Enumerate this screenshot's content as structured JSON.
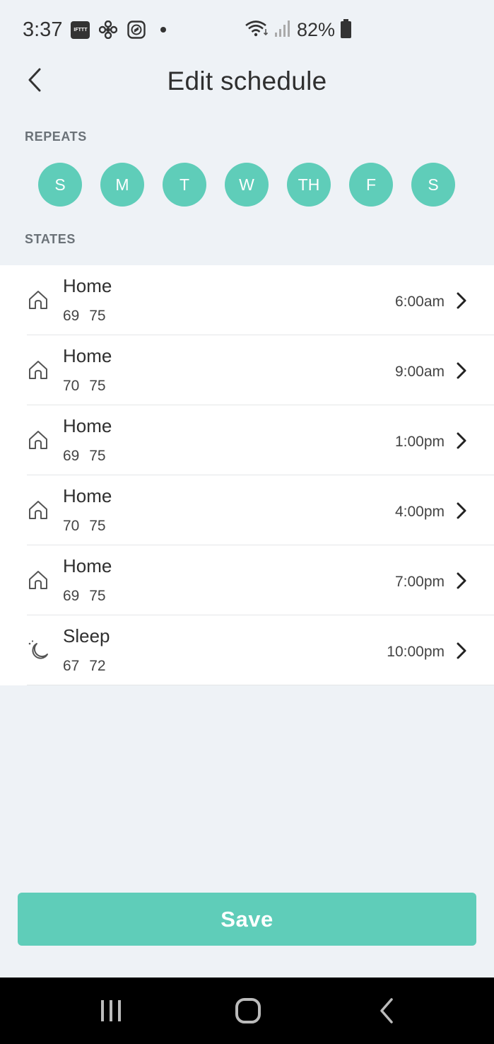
{
  "status_bar": {
    "time": "3:37",
    "icons": [
      "ifttt-icon",
      "fan-icon",
      "shazam-icon",
      "dot-icon",
      "wifi-icon",
      "signal-icon",
      "battery-icon"
    ],
    "ifttt_text": "IFTTT",
    "battery_percent": "82%"
  },
  "header": {
    "title": "Edit schedule",
    "back_icon": "chevron-left-icon"
  },
  "repeats": {
    "label": "REPEATS",
    "days": [
      "S",
      "M",
      "T",
      "W",
      "TH",
      "F",
      "S"
    ],
    "active_color": "#5fcdb9"
  },
  "states": {
    "label": "STATES",
    "items": [
      {
        "name": "Home",
        "low": "69",
        "high": "75",
        "time": "6:00am",
        "icon": "home-icon"
      },
      {
        "name": "Home",
        "low": "70",
        "high": "75",
        "time": "9:00am",
        "icon": "home-icon"
      },
      {
        "name": "Home",
        "low": "69",
        "high": "75",
        "time": "1:00pm",
        "icon": "home-icon"
      },
      {
        "name": "Home",
        "low": "70",
        "high": "75",
        "time": "4:00pm",
        "icon": "home-icon"
      },
      {
        "name": "Home",
        "low": "69",
        "high": "75",
        "time": "7:00pm",
        "icon": "home-icon"
      },
      {
        "name": "Sleep",
        "low": "67",
        "high": "72",
        "time": "10:00pm",
        "icon": "moon-icon"
      }
    ]
  },
  "save_label": "Save",
  "colors": {
    "accent": "#5fcdb9",
    "background": "#eef2f6"
  },
  "nav_bar": {
    "buttons": [
      "recent-apps-icon",
      "home-button-icon",
      "back-icon"
    ]
  }
}
